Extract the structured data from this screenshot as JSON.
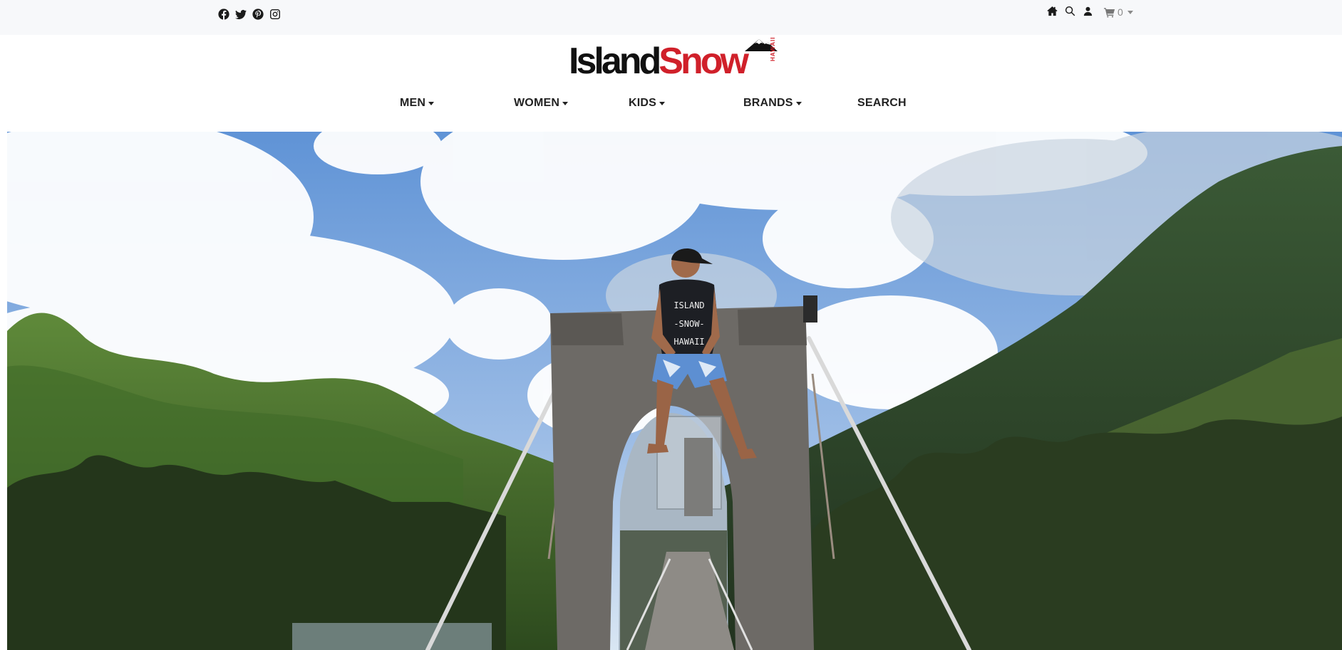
{
  "header": {
    "social_icons": [
      "facebook-icon",
      "twitter-icon",
      "pinterest-icon",
      "instagram-icon"
    ],
    "utility_icons": [
      "home-icon",
      "search-icon",
      "account-icon"
    ],
    "cart": {
      "icon": "cart-icon",
      "count": "0"
    }
  },
  "logo": {
    "part1": "Island",
    "part2": "Snow",
    "tag": "HAWAII"
  },
  "nav": {
    "items": [
      {
        "label": "MEN",
        "dropdown": true
      },
      {
        "label": "WOMEN",
        "dropdown": true
      },
      {
        "label": "KIDS",
        "dropdown": true
      },
      {
        "label": "BRANDS",
        "dropdown": true
      },
      {
        "label": "SEARCH",
        "dropdown": false
      }
    ]
  },
  "hero": {
    "shirt_text": [
      "ISLAND",
      "-SNOW-",
      "HAWAII"
    ]
  },
  "colors": {
    "brand_red": "#d0202a",
    "topbar_bg": "#f7f8fa",
    "text_dark": "#222222"
  }
}
